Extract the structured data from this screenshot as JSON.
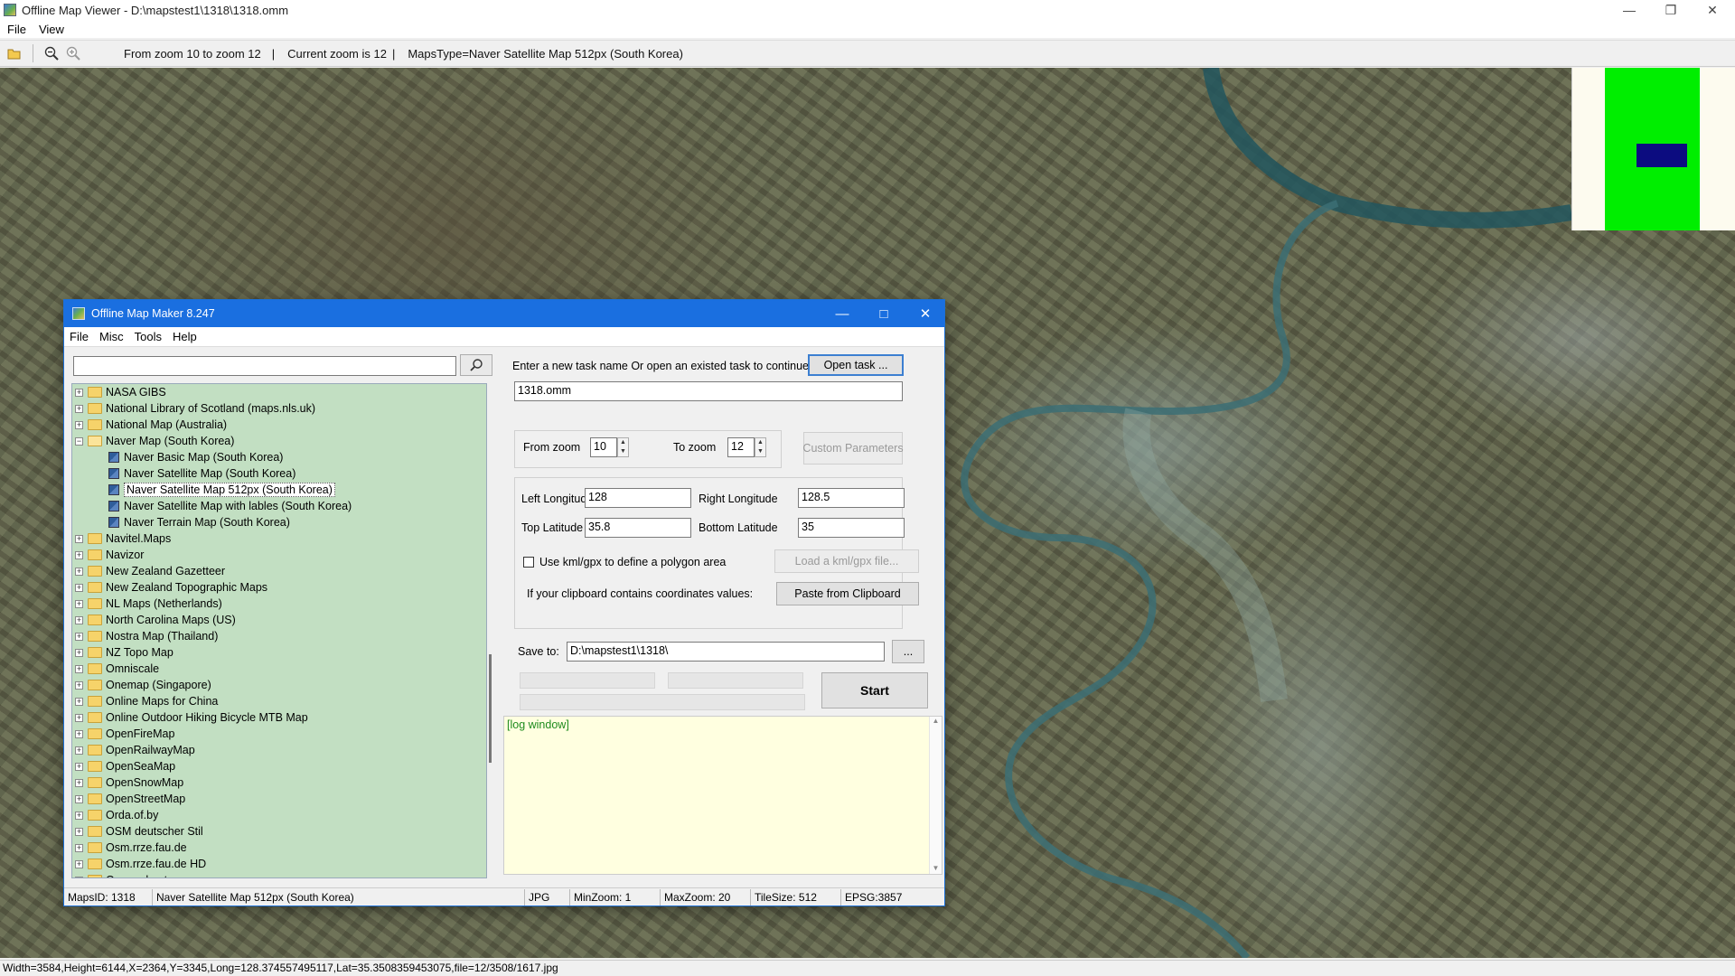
{
  "window": {
    "title": "Offline Map Viewer - D:\\mapstest1\\1318\\1318.omm"
  },
  "menu": [
    "File",
    "View"
  ],
  "toolbar": {
    "zoom_range": "From zoom 10 to zoom 12",
    "separator": "|",
    "current_zoom": "Current zoom is 12",
    "maps_type": "MapsType=Naver Satellite Map 512px (South Korea)"
  },
  "statusbar": {
    "text": "Width=3584,Height=6144,X=2364,Y=3345,Long=128.374557495117,Lat=35.3508359453075,file=12/3508/1617.jpg"
  },
  "dialog": {
    "title": "Offline Map Maker 8.247",
    "menu": [
      "File",
      "Misc",
      "Tools",
      "Help"
    ],
    "search": {
      "value": ""
    },
    "tree": [
      {
        "label": "NASA GIBS",
        "level": 0,
        "expanded": false
      },
      {
        "label": "National Library of Scotland (maps.nls.uk)",
        "level": 0,
        "expanded": false
      },
      {
        "label": "National Map (Australia)",
        "level": 0,
        "expanded": false
      },
      {
        "label": "Naver Map (South Korea)",
        "level": 0,
        "expanded": true
      },
      {
        "label": "Naver Basic Map (South Korea)",
        "level": 1
      },
      {
        "label": "Naver Satellite Map (South Korea)",
        "level": 1
      },
      {
        "label": "Naver Satellite Map 512px (South Korea)",
        "level": 1,
        "selected": true
      },
      {
        "label": "Naver Satellite Map with lables (South Korea)",
        "level": 1
      },
      {
        "label": "Naver Terrain Map (South Korea)",
        "level": 1
      },
      {
        "label": "Navitel.Maps",
        "level": 0,
        "expanded": false
      },
      {
        "label": "Navizor",
        "level": 0,
        "expanded": false
      },
      {
        "label": "New Zealand Gazetteer",
        "level": 0,
        "expanded": false
      },
      {
        "label": "New Zealand Topographic Maps",
        "level": 0,
        "expanded": false
      },
      {
        "label": "NL Maps (Netherlands)",
        "level": 0,
        "expanded": false
      },
      {
        "label": "North Carolina Maps (US)",
        "level": 0,
        "expanded": false
      },
      {
        "label": "Nostra Map (Thailand)",
        "level": 0,
        "expanded": false
      },
      {
        "label": "NZ Topo Map",
        "level": 0,
        "expanded": false
      },
      {
        "label": "Omniscale",
        "level": 0,
        "expanded": false
      },
      {
        "label": "Onemap (Singapore)",
        "level": 0,
        "expanded": false
      },
      {
        "label": "Online Maps for China",
        "level": 0,
        "expanded": false
      },
      {
        "label": "Online Outdoor Hiking Bicycle MTB Map",
        "level": 0,
        "expanded": false
      },
      {
        "label": "OpenFireMap",
        "level": 0,
        "expanded": false
      },
      {
        "label": "OpenRailwayMap",
        "level": 0,
        "expanded": false
      },
      {
        "label": "OpenSeaMap",
        "level": 0,
        "expanded": false
      },
      {
        "label": "OpenSnowMap",
        "level": 0,
        "expanded": false
      },
      {
        "label": "OpenStreetMap",
        "level": 0,
        "expanded": false
      },
      {
        "label": "Orda.of.by",
        "level": 0,
        "expanded": false
      },
      {
        "label": "OSM deutscher Stil",
        "level": 0,
        "expanded": false
      },
      {
        "label": "Osm.rrze.fau.de",
        "level": 0,
        "expanded": false
      },
      {
        "label": "Osm.rrze.fau.de HD",
        "level": 0,
        "expanded": false
      },
      {
        "label": "Osmand.net",
        "level": 0,
        "expanded": false
      }
    ],
    "task": {
      "prompt": "Enter a new task name Or open an existed task to continue:",
      "open_button": "Open task ...",
      "name": "1318.omm"
    },
    "zoom": {
      "from_label": "From zoom",
      "from_value": "10",
      "to_label": "To zoom",
      "to_value": "12",
      "custom_button": "Custom Parameters"
    },
    "coords": {
      "left_lon_label": "Left Longitude",
      "left_lon": "128",
      "right_lon_label": "Right Longitude",
      "right_lon": "128.5",
      "top_lat_label": "Top Latitude",
      "top_lat": "35.8",
      "bottom_lat_label": "Bottom Latitude",
      "bottom_lat": "35",
      "kml_label": "Use kml/gpx to define a polygon area",
      "kml_button": "Load a kml/gpx file...",
      "clipboard_label": "If your clipboard contains coordinates values:",
      "clipboard_button": "Paste from Clipboard"
    },
    "save": {
      "label": "Save to:",
      "path": "D:\\mapstest1\\1318\\",
      "browse": "..."
    },
    "start_button": "Start",
    "log": "[log window]",
    "status": {
      "maps_id": "MapsID: 1318",
      "map_name": "Naver Satellite Map 512px (South Korea)",
      "format": "JPG",
      "min_zoom": "MinZoom: 1",
      "max_zoom": "MaxZoom: 20",
      "tile_size": "TileSize: 512",
      "epsg": "EPSG:3857"
    }
  },
  "colors": {
    "dialog_title": "#1a6fe0",
    "tree_bg": "#c2dfc2",
    "log_bg": "#ffffe0",
    "minimap_green": "#00ee00",
    "minimap_view": "#0c0c80"
  }
}
